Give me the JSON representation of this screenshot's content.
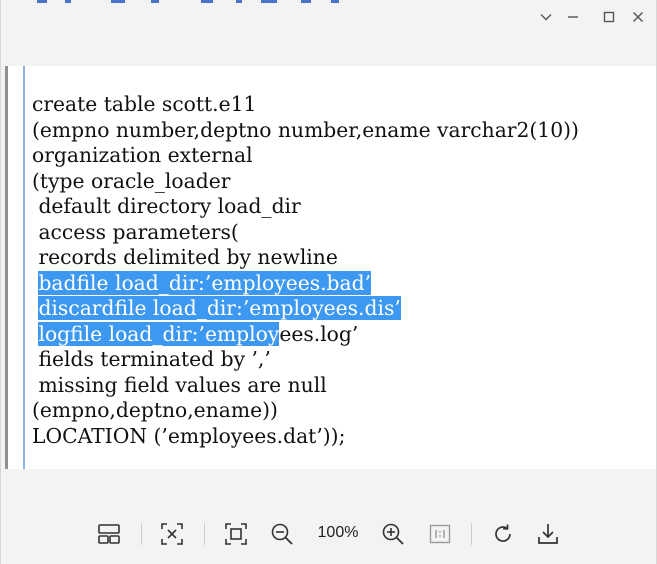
{
  "code_lines": [
    {
      "pre": "create table scott.e11",
      "sel": "",
      "post": ""
    },
    {
      "pre": "(empno number,deptno number,ename varchar2(10))",
      "sel": "",
      "post": ""
    },
    {
      "pre": "organization external",
      "sel": "",
      "post": ""
    },
    {
      "pre": "(type oracle_loader",
      "sel": "",
      "post": ""
    },
    {
      "pre": " default directory load_dir",
      "sel": "",
      "post": ""
    },
    {
      "pre": " access parameters(",
      "sel": "",
      "post": ""
    },
    {
      "pre": " records delimited by newline",
      "sel": "",
      "post": ""
    },
    {
      "pre": " ",
      "sel": "badfile load_dir:’employees.bad’",
      "post": ""
    },
    {
      "pre": " ",
      "sel": "discardfile load_dir:’employees.dis’",
      "post": ""
    },
    {
      "pre": " ",
      "sel": "logfile load_dir:’employ",
      "post": "ees.log’"
    },
    {
      "pre": " fields terminated by ’,’",
      "sel": "",
      "post": ""
    },
    {
      "pre": " missing field values are null",
      "sel": "",
      "post": ""
    },
    {
      "pre": "(empno,deptno,ename))",
      "sel": "",
      "post": ""
    },
    {
      "pre": "LOCATION (’employees.dat’));",
      "sel": "",
      "post": ""
    }
  ],
  "toolbar": {
    "zoom_level": "100%"
  },
  "icons": {
    "minimize": "minimize-icon",
    "maximize": "maximize-icon",
    "close": "close-icon",
    "collapse": "chevron-down-icon",
    "layout": "layout-icon",
    "fit": "fit-screen-icon",
    "actual": "actual-size-icon",
    "zoom_out": "zoom-out-icon",
    "zoom_in": "zoom-in-icon",
    "one_to_one": "one-to-one-icon",
    "rotate": "rotate-icon",
    "download": "download-icon"
  },
  "colors": {
    "selection": "#3c98f0",
    "accent": "#4a73c9"
  }
}
